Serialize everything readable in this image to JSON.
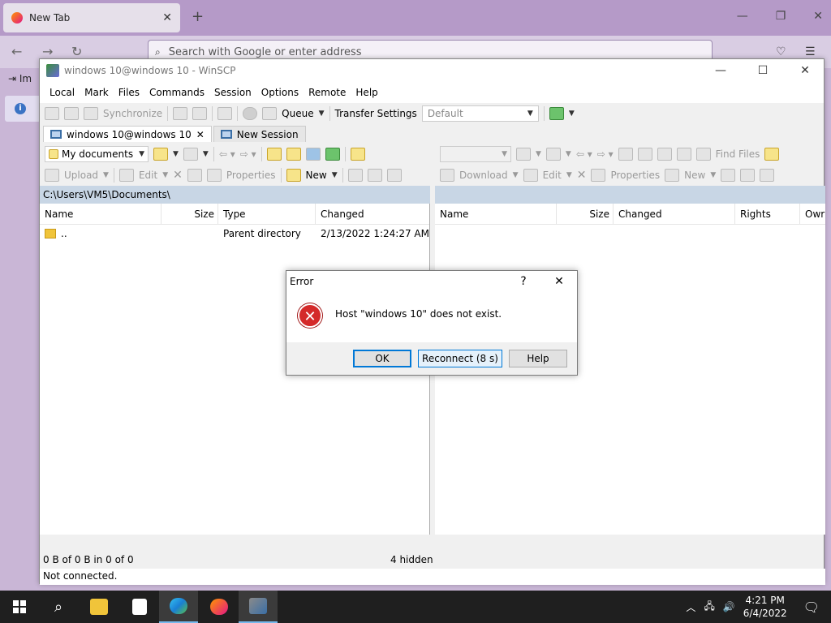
{
  "firefox": {
    "tab_title": "New Tab",
    "tab_close": "✕",
    "new_tab": "+",
    "url_placeholder": "Search with Google or enter address",
    "bookmark_partial": "Im",
    "info_partial": "i"
  },
  "winscp": {
    "title": "windows 10@windows 10 - WinSCP",
    "menu": [
      "Local",
      "Mark",
      "Files",
      "Commands",
      "Session",
      "Options",
      "Remote",
      "Help"
    ],
    "toolbar": {
      "synchronize": "Synchronize",
      "queue": "Queue",
      "transfer_settings_label": "Transfer Settings",
      "transfer_settings_value": "Default"
    },
    "session_tabs": [
      {
        "label": "windows 10@windows 10",
        "close": "✕"
      },
      {
        "label": "New Session"
      }
    ],
    "left_panel": {
      "location": "My documents",
      "upload": "Upload",
      "edit": "Edit",
      "properties": "Properties",
      "new": "New",
      "path": "C:\\Users\\VM5\\Documents\\",
      "columns": [
        "Name",
        "Size",
        "Type",
        "Changed"
      ],
      "rows": [
        {
          "name": "..",
          "size": "",
          "type": "Parent directory",
          "changed": "2/13/2022  1:24:27 AM"
        }
      ]
    },
    "right_panel": {
      "find_files": "Find Files",
      "download": "Download",
      "edit": "Edit",
      "properties": "Properties",
      "new": "New",
      "columns": [
        "Name",
        "Size",
        "Changed",
        "Rights",
        "Owr"
      ]
    },
    "status": {
      "selection": "0 B of 0 B in 0 of 0",
      "hidden": "4 hidden",
      "connection": "Not connected."
    }
  },
  "dialog": {
    "title": "Error",
    "help_glyph": "?",
    "close_glyph": "✕",
    "message": "Host \"windows 10\" does not exist.",
    "ok": "OK",
    "reconnect": "Reconnect (8 s)",
    "help": "Help"
  },
  "taskbar": {
    "time": "4:21 PM",
    "date": "6/4/2022"
  },
  "colors": {
    "accent": "#0078d7",
    "error": "#d42a2a",
    "firefox_bg": "#c9b6d6"
  }
}
